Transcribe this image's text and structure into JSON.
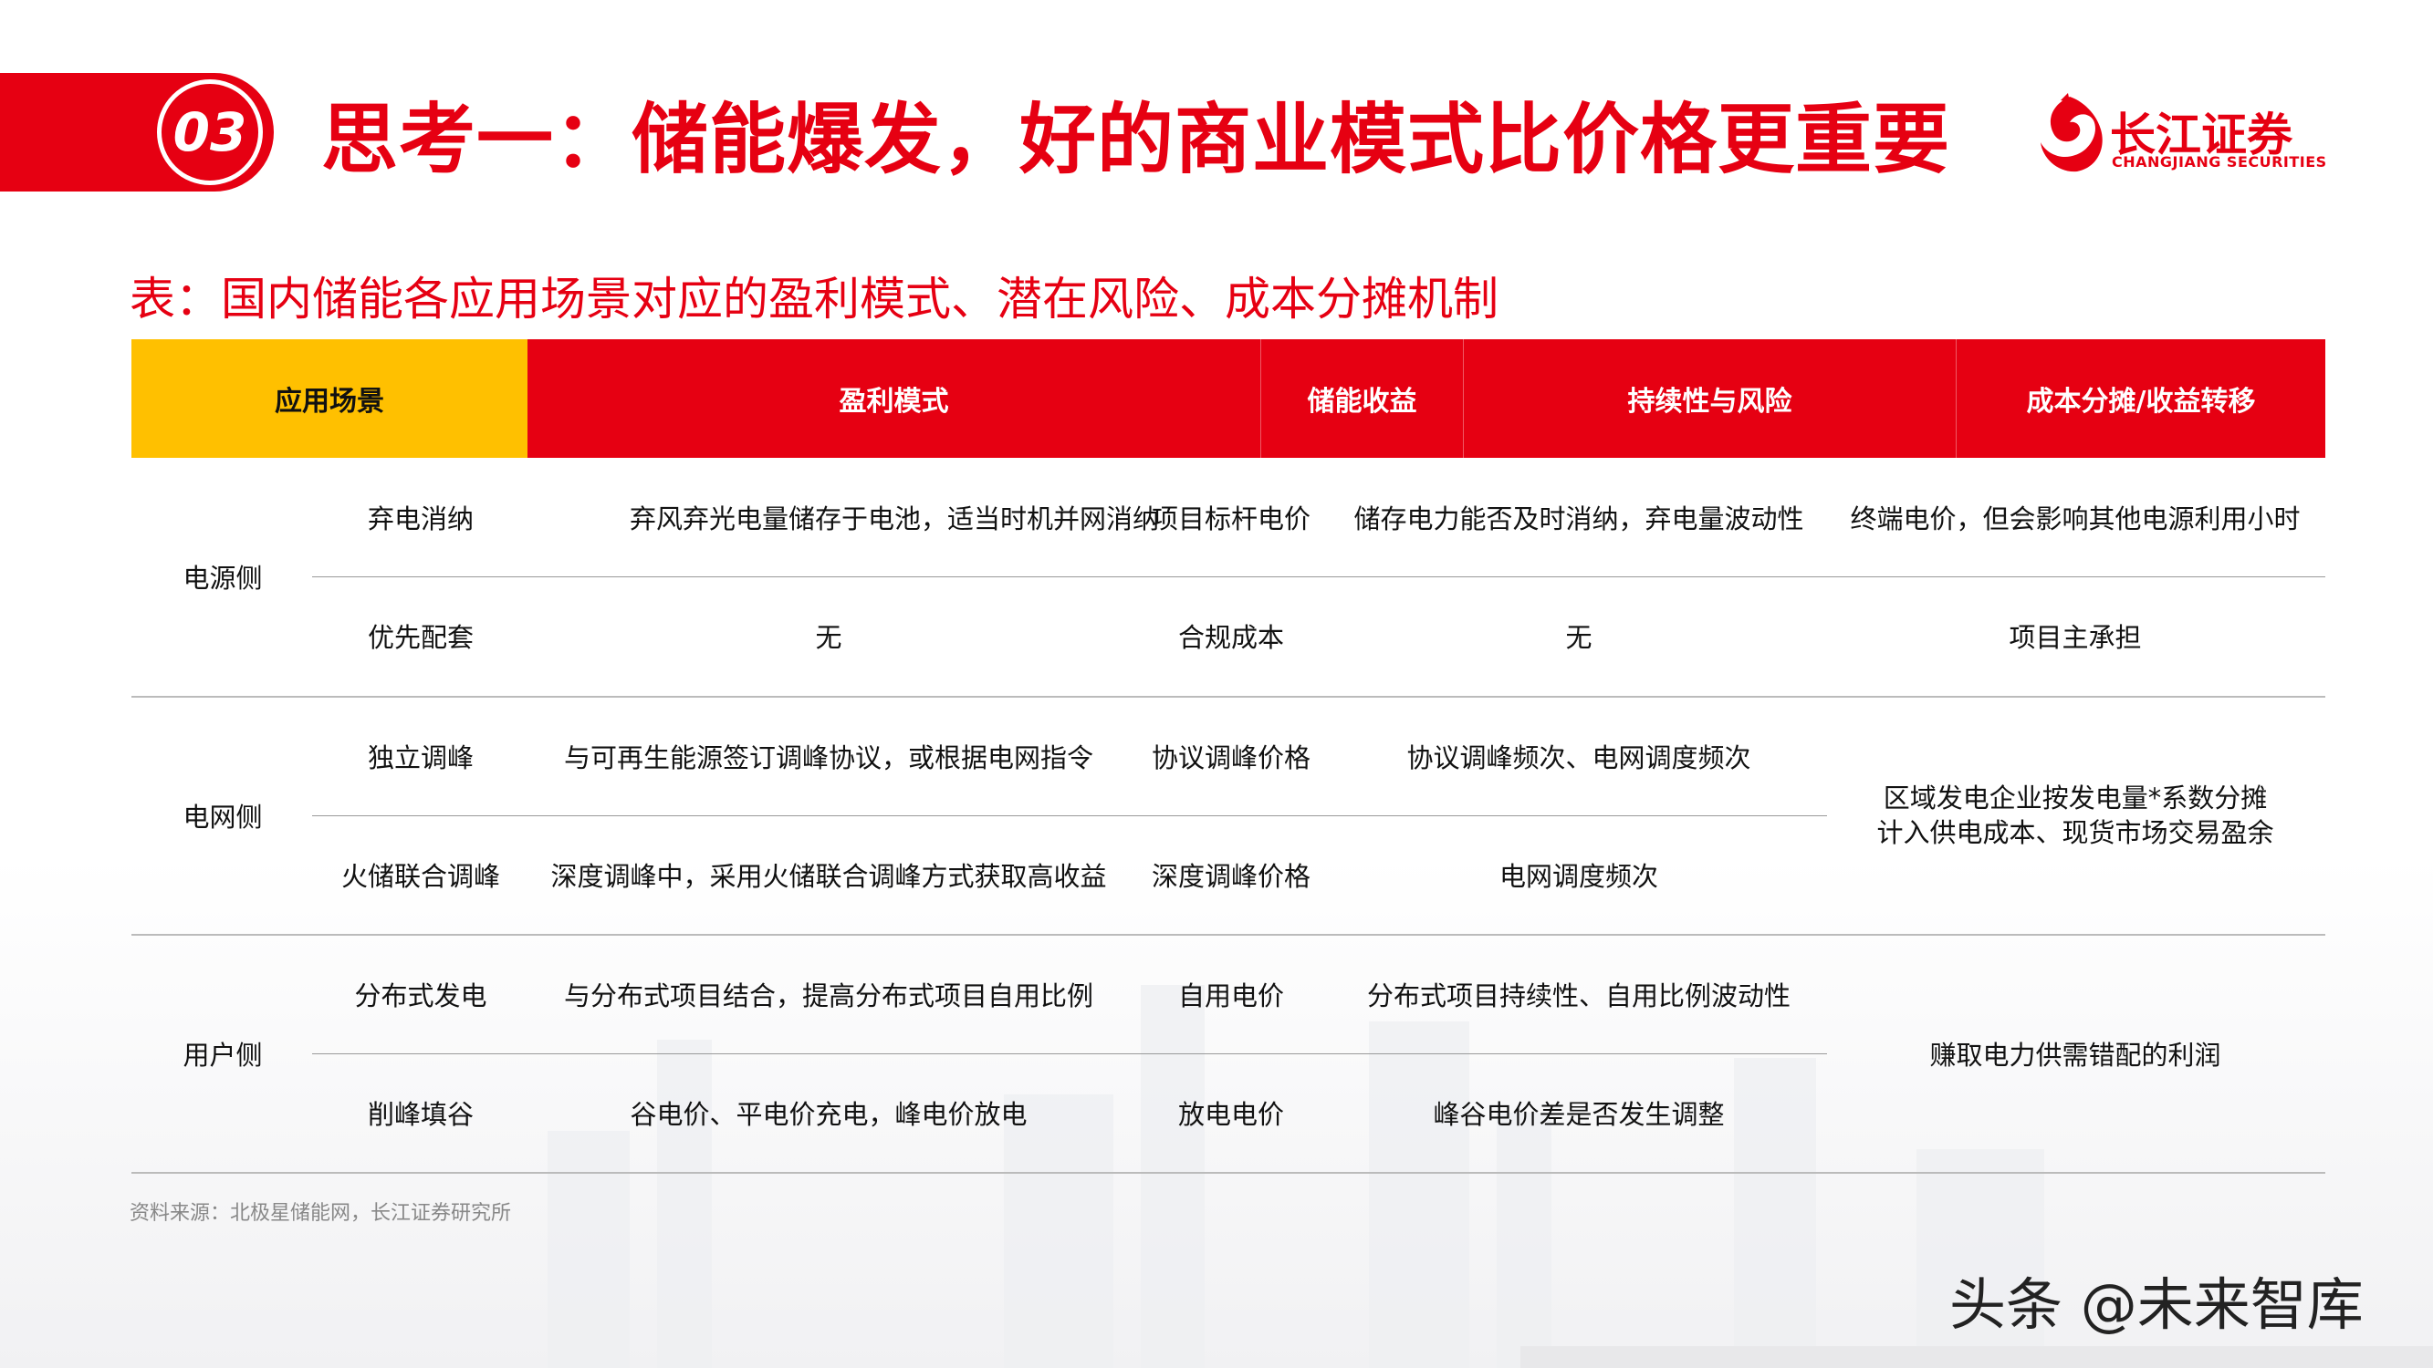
{
  "header": {
    "section_number": "03",
    "title": "思考一：储能爆发，好的商业模式比价格更重要"
  },
  "logo": {
    "name_cn": "长江证券",
    "name_en": "CHANGJIANG SECURITIES"
  },
  "subtitle": "表：国内储能各应用场景对应的盈利模式、潜在风险、成本分摊机制",
  "table": {
    "headers": [
      "应用场景",
      "盈利模式",
      "储能收益",
      "持续性与风险",
      "成本分摊/收益转移"
    ],
    "groups": [
      {
        "label": "电源侧",
        "rows": [
          {
            "scenario": "弃电消纳",
            "profit_model": "弃风弃光电量储存于电池，适当时机并网消纳",
            "revenue": "项目标杆电价",
            "risk": "储存电力能否及时消纳，弃电量波动性",
            "cost_sharing": "终端电价，但会影响其他电源利用小时"
          },
          {
            "scenario": "优先配套",
            "profit_model": "无",
            "revenue": "合规成本",
            "risk": "无",
            "cost_sharing": "项目主承担"
          }
        ]
      },
      {
        "label": "电网侧",
        "shared_cost_sharing": [
          "区域发电企业按发电量*系数分摊",
          "计入供电成本、现货市场交易盈余"
        ],
        "rows": [
          {
            "scenario": "独立调峰",
            "profit_model": "与可再生能源签订调峰协议，或根据电网指令",
            "revenue": "协议调峰价格",
            "risk": "协议调峰频次、电网调度频次"
          },
          {
            "scenario": "火储联合调峰",
            "profit_model": "深度调峰中，采用火储联合调峰方式获取高收益",
            "revenue": "深度调峰价格",
            "risk": "电网调度频次"
          }
        ]
      },
      {
        "label": "用户侧",
        "shared_cost_sharing": [
          "赚取电力供需错配的利润"
        ],
        "rows": [
          {
            "scenario": "分布式发电",
            "profit_model": "与分布式项目结合，提高分布式项目自用比例",
            "revenue": "自用电价",
            "risk": "分布式项目持续性、自用比例波动性"
          },
          {
            "scenario": "削峰填谷",
            "profit_model": "谷电价、平电价充电，峰电价放电",
            "revenue": "放电电价",
            "risk": "峰谷电价差是否发生调整"
          }
        ]
      }
    ]
  },
  "source": "资料来源：北极星储能网，长江证券研究所",
  "watermark": "头条 @未来智库",
  "colors": {
    "brand_red": "#e60012",
    "header_yellow": "#ffc000"
  }
}
